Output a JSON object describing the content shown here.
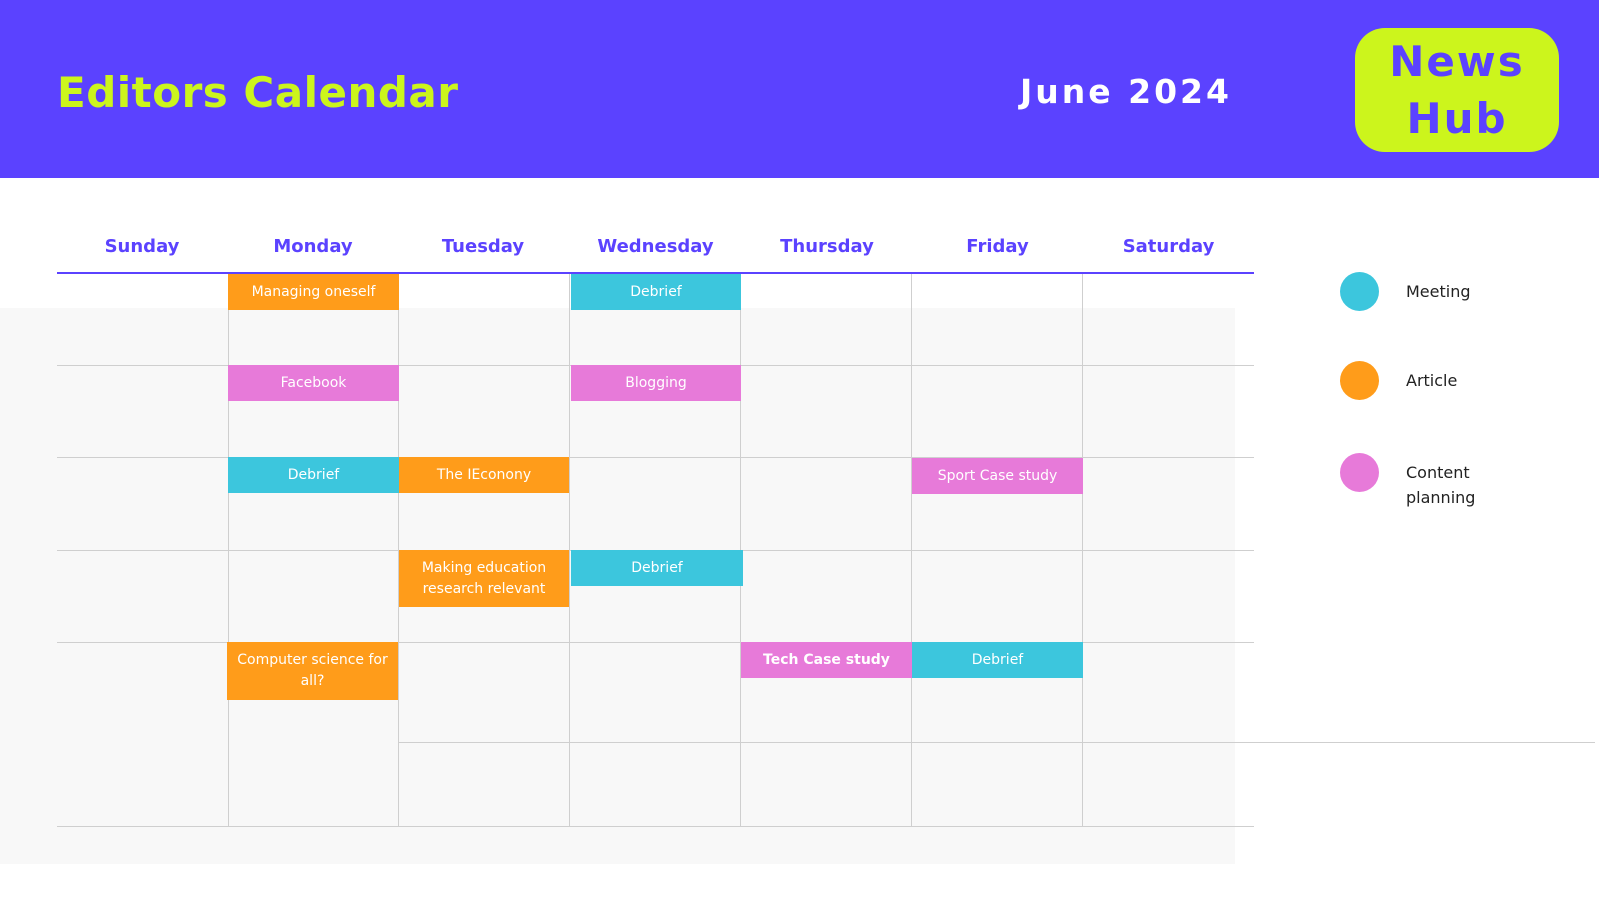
{
  "header": {
    "title": "Editors Calendar",
    "month": "June 2024",
    "logo_line1": "News",
    "logo_line2": "Hub"
  },
  "colors": {
    "header_bg": "#5b42ff",
    "title": "#ccf51c",
    "logo_bg": "#ccf51c",
    "meeting": "#3cc6dd",
    "article": "#ff9c1a",
    "content_planning": "#e77ad9"
  },
  "days": [
    "Sunday",
    "Monday",
    "Tuesday",
    "Wednesday",
    "Thursday",
    "Friday",
    "Saturday"
  ],
  "events": {
    "mon_1": "Managing oneself",
    "wed_1": "Debrief",
    "mon_2": "Facebook",
    "wed_2": "Blogging",
    "mon_3": "Debrief",
    "tue_3": "The IEconony",
    "fri_3": "Sport Case study",
    "tue_4": "Making education research relevant",
    "wed_4": "Debrief",
    "mon_5": "Computer science for all?",
    "thu_5": "Tech Case study",
    "fri_5": "Debrief"
  },
  "legend": {
    "meeting": "Meeting",
    "article": "Article",
    "content_planning": "Content planning"
  }
}
